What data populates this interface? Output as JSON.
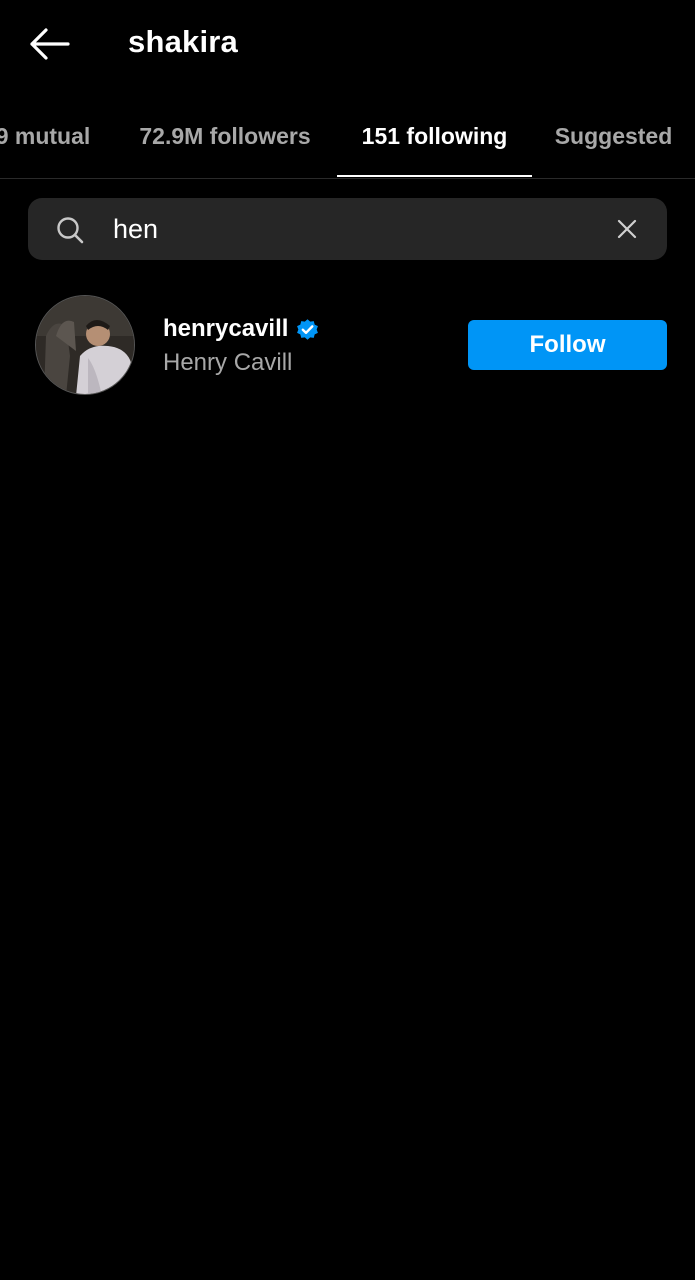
{
  "header": {
    "title": "shakira",
    "back_icon": "arrow-left-icon"
  },
  "tabs": [
    {
      "label": "9 mutual",
      "active": false
    },
    {
      "label": "72.9M followers",
      "active": false
    },
    {
      "label": "151 following",
      "active": true
    },
    {
      "label": "Suggested",
      "active": false
    }
  ],
  "search": {
    "value": "hen",
    "icon": "search-icon",
    "clear_icon": "close-icon"
  },
  "results": [
    {
      "username": "henrycavill",
      "full_name": "Henry Cavill",
      "verified": true,
      "button_label": "Follow"
    }
  ],
  "colors": {
    "background": "#000000",
    "accent": "#0095f6",
    "secondary_text": "#a8a8a8",
    "search_bg": "#262626"
  }
}
